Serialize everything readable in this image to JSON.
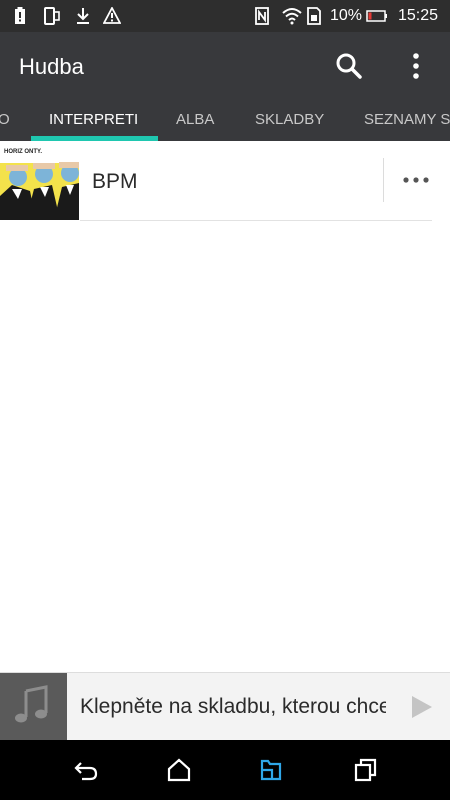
{
  "status_bar": {
    "battery_percent": "10%",
    "time": "15:25",
    "icons": [
      "battery-alert-icon",
      "phone-icon",
      "download-icon",
      "warning-icon",
      "nfc-icon",
      "wifi-icon",
      "sim-icon",
      "battery-icon"
    ]
  },
  "app_bar": {
    "title": "Hudba",
    "actions": [
      "search-icon",
      "more-vert-icon"
    ]
  },
  "tabs": [
    {
      "label": "O"
    },
    {
      "label": "INTERPRETI",
      "active": true
    },
    {
      "label": "ALBA"
    },
    {
      "label": "SKLADBY"
    },
    {
      "label": "SEZNAMY S"
    }
  ],
  "artists": [
    {
      "name": "BPM",
      "art_text": "HORIZ ONTY."
    }
  ],
  "mini_player": {
    "prompt": "Klepněte na skladbu, kterou chce"
  },
  "nav_bar": [
    "back-icon",
    "home-icon",
    "recents-icon",
    "overview-icon"
  ],
  "colors": {
    "status_bar": "#2e2e2e",
    "app_bar": "#38393c",
    "accent": "#1fc7b0",
    "nav_active": "#2fa7e8"
  }
}
